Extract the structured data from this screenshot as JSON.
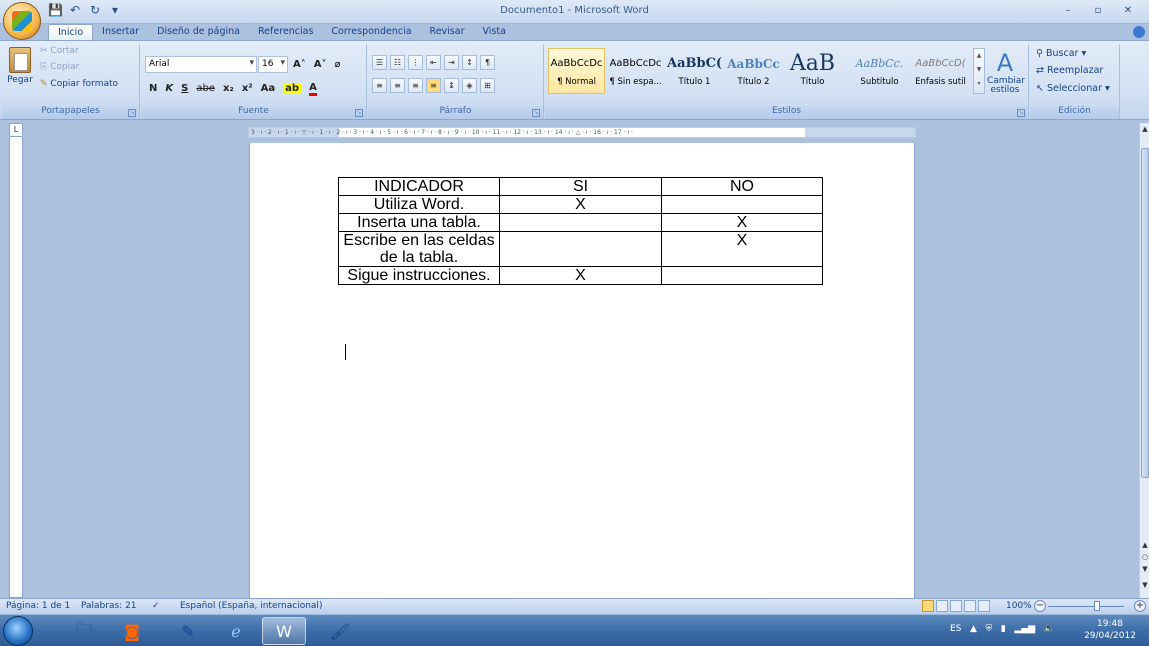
{
  "window": {
    "title": "Documento1 - Microsoft Word"
  },
  "qat": {
    "save": "💾",
    "undo": "↶",
    "redo": "↻",
    "more": "▾"
  },
  "tabs": [
    "Inicio",
    "Insertar",
    "Diseño de página",
    "Referencias",
    "Correspondencia",
    "Revisar",
    "Vista"
  ],
  "clipboard": {
    "paste": "Pegar",
    "cut": "Cortar",
    "copy": "Copiar",
    "format_painter": "Copiar formato",
    "label": "Portapapeles"
  },
  "font": {
    "name": "Arial",
    "size": "16",
    "label": "Fuente",
    "row2": [
      "N",
      "K",
      "S",
      "abe",
      "x₂",
      "x²",
      "Aa"
    ]
  },
  "paragraph": {
    "label": "Párrafo"
  },
  "styles": {
    "label": "Estilos",
    "items": [
      {
        "sample": "AaBbCcDc",
        "name": "¶ Normal"
      },
      {
        "sample": "AaBbCcDc",
        "name": "¶ Sin espa..."
      },
      {
        "sample": "AaBbC(",
        "name": "Título 1"
      },
      {
        "sample": "AaBbCc",
        "name": "Título 2"
      },
      {
        "sample": "AaB",
        "name": "Título"
      },
      {
        "sample": "AaBbCc.",
        "name": "Subtítulo"
      },
      {
        "sample": "AaBbCcD(",
        "name": "Énfasis sutil"
      }
    ],
    "change_label": "Cambiar estilos"
  },
  "editing": {
    "find": "Buscar",
    "replace": "Reemplazar",
    "select": "Seleccionar",
    "label": "Edición"
  },
  "ruler": {
    "h": "3 · ı · 2 · ı · 1 · ı · ▽ · ı · 1 · ı · 2 · ı · 3 · ı · 4 · ı · 5 · ı · 6 · ı · 7 · ı · 8 · ı · 9 · ı · 10 · ı · 11 · ı · 12 · ı · 13 · ı · 14 · ı · △ · ı · 16 · ı · 17 · ı ·",
    "corner": "L"
  },
  "table": {
    "header": [
      "INDICADOR",
      "SI",
      "NO"
    ],
    "rows": [
      [
        "Utiliza Word.",
        "X",
        ""
      ],
      [
        "Inserta una tabla.",
        "",
        "X"
      ],
      [
        "Escribe en las celdas de la tabla.",
        "",
        "X"
      ],
      [
        "Sigue instrucciones.",
        "X",
        ""
      ]
    ]
  },
  "status": {
    "page": "Página: 1 de 1",
    "words": "Palabras: 21",
    "language": "Español (España, internacional)",
    "zoom": "100%"
  },
  "taskbar": {
    "lang": "ES",
    "time": "19:48",
    "date": "29/04/2012"
  }
}
